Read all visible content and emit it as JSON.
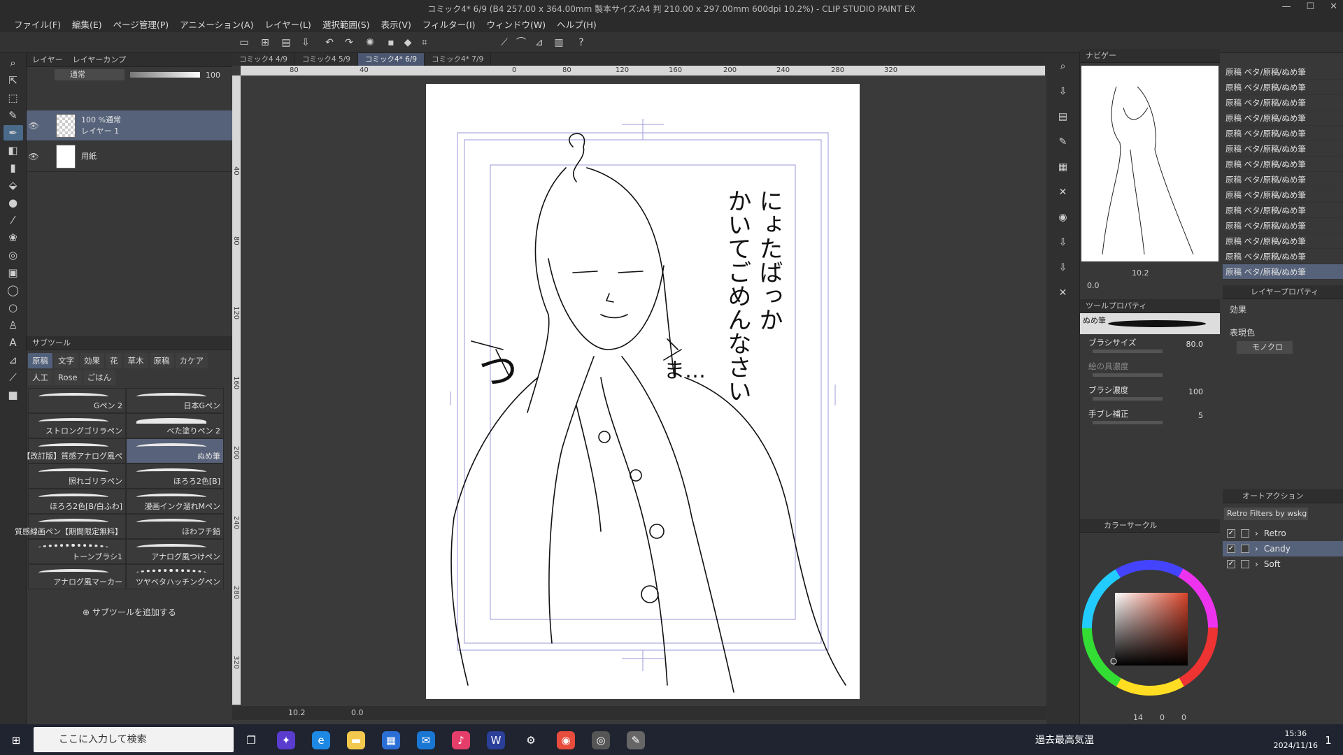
{
  "window": {
    "title": "コミック4* 6/9 (B4 257.00 x 364.00mm 製本サイズ:A4 判 210.00 x 297.00mm 600dpi 10.2%) - CLIP STUDIO PAINT EX",
    "buttons": [
      "—",
      "☐",
      "✕"
    ]
  },
  "menu": [
    "ファイル(F)",
    "編集(E)",
    "ページ管理(P)",
    "アニメーション(A)",
    "レイヤー(L)",
    "選択範囲(S)",
    "表示(V)",
    "フィルター(I)",
    "ウィンドウ(W)",
    "ヘルプ(H)"
  ],
  "layer_panel": {
    "tabs": [
      "レイヤー",
      "レイヤーカンプ"
    ],
    "blend_mode": "通常",
    "opacity": "100",
    "layers": [
      {
        "line1": "100 %通常",
        "line2": "レイヤー 1"
      },
      {
        "line1": "",
        "line2": "用紙"
      }
    ]
  },
  "subtool_panel": {
    "title": "サブツール",
    "tabs": [
      "原稿",
      "文字",
      "効果",
      "花",
      "草木",
      "原稿",
      "カケア",
      "人工",
      "Rose",
      "ごはん"
    ],
    "brushes": [
      "Gペン 2",
      "日本Gペン",
      "ストロングゴリラペン",
      "べた塗りペン 2",
      "【改訂版】質感アナログ風ペ",
      "ぬめ筆",
      "照れゴリラペン",
      "ほろろ2色[B]",
      "ほろろ2色[B/白ふわ]",
      "漫画インク溜れMペン",
      "質感線画ペン【期間限定無料】",
      "ほわフチ鉛",
      "トーンブラシ1",
      "アナログ風つけペン",
      "アナログ風マーカー",
      "ツヤベタハッチングペン"
    ],
    "add_label": "サブツールを追加する"
  },
  "canvas_tabs": [
    "コミック4  4/9",
    "コミック4  5/9",
    "コミック4*  6/9",
    "コミック4*  7/9"
  ],
  "ruler_h": [
    "80",
    "40",
    "0",
    "80",
    "120",
    "160",
    "200",
    "240",
    "280",
    "320"
  ],
  "ruler_v": [
    "40",
    "80",
    "120",
    "160",
    "200",
    "240",
    "280",
    "320"
  ],
  "manuscript_text": {
    "col1": "にょたばっか",
    "col2": "かいてごめんなさい",
    "scribble1": "つ",
    "scribble2": "ま…"
  },
  "status": {
    "zoom": "10.2",
    "rotate": "0.0"
  },
  "navigator": {
    "title": "ナビゲー",
    "zoom": "10.2",
    "rotate": "0.0"
  },
  "tool_property": {
    "title": "ツールプロパティ",
    "brush_name": "ぬめ筆",
    "props": [
      {
        "label": "ブラシサイズ",
        "value": "80.0"
      },
      {
        "label": "絵の具濃度",
        "value": ""
      },
      {
        "label": "ブラシ濃度",
        "value": "100"
      },
      {
        "label": "手ブレ補正",
        "value": "5"
      }
    ]
  },
  "layer_props": {
    "title": "レイヤープロパティ",
    "effect_label": "効果",
    "expr_label": "表現色",
    "expr_value": "モノクロ"
  },
  "layer_list": [
    "原稿 ベタ/原稿/ぬめ筆",
    "原稿 ベタ/原稿/ぬめ筆",
    "原稿 ベタ/原稿/ぬめ筆",
    "原稿 ベタ/原稿/ぬめ筆",
    "原稿 ベタ/原稿/ぬめ筆",
    "原稿 ベタ/原稿/ぬめ筆",
    "原稿 ベタ/原稿/ぬめ筆",
    "原稿 ベタ/原稿/ぬめ筆",
    "原稿 ベタ/原稿/ぬめ筆",
    "原稿 ベタ/原稿/ぬめ筆",
    "原稿 ベタ/原稿/ぬめ筆",
    "原稿 ベタ/原稿/ぬめ筆",
    "原稿 ベタ/原稿/ぬめ筆",
    "原稿 ベタ/原稿/ぬめ筆"
  ],
  "color_circle": {
    "title": "カラーサークル",
    "hue_color": "#d8442a"
  },
  "auto_action": {
    "title": "オートアクション",
    "set_name": "Retro Filters by wskg",
    "items": [
      "Retro",
      "Candy",
      "Soft"
    ]
  },
  "bottom_counts": {
    "a": "14",
    "b": "0",
    "c": "0"
  },
  "taskbar": {
    "search_placeholder": "ここに入力して検索",
    "weather": "過去最高気温",
    "time": "15:36",
    "date": "2024/11/16",
    "notif": "1"
  }
}
